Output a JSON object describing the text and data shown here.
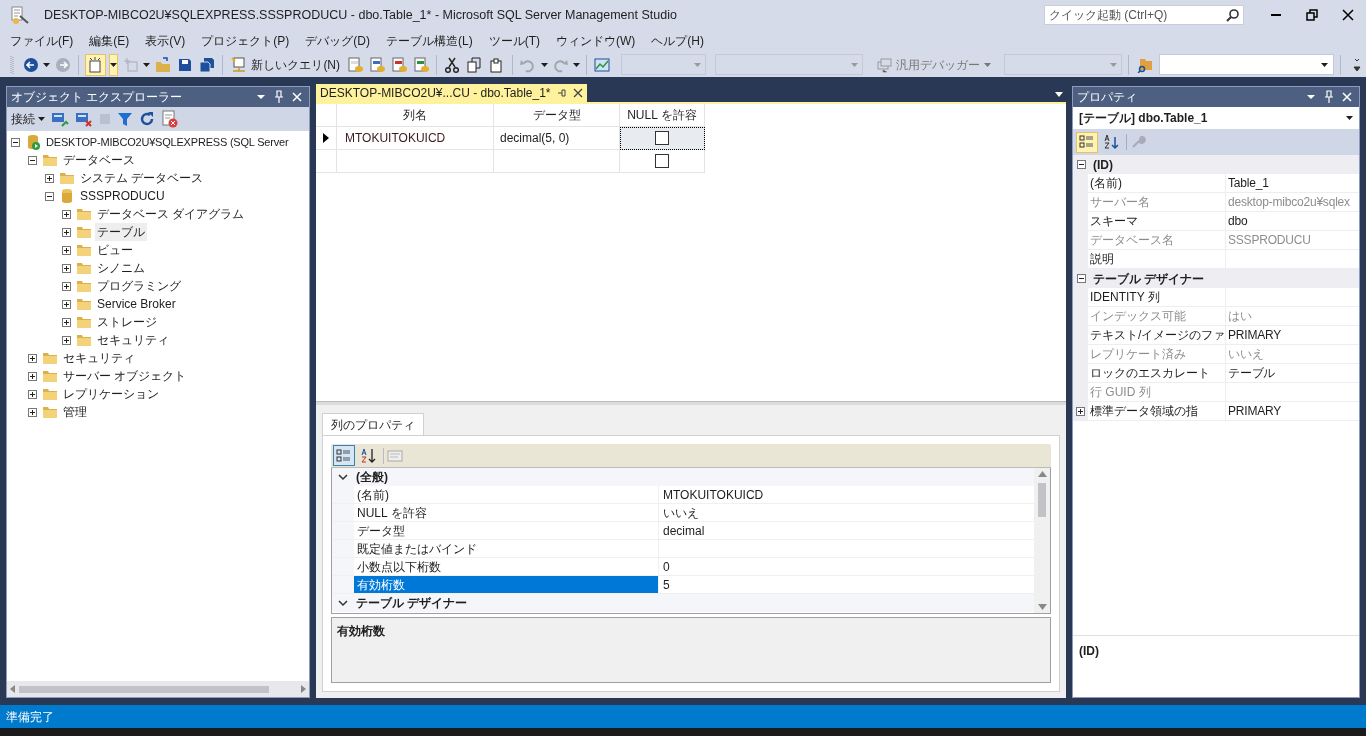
{
  "window": {
    "title": "DESKTOP-MIBCO2U¥SQLEXPRESS.SSSPRODUCU - dbo.Table_1* - Microsoft SQL Server Management Studio"
  },
  "quick_launch": {
    "placeholder": "クイック起動 (Ctrl+Q)"
  },
  "menu": [
    "ファイル(F)",
    "編集(E)",
    "表示(V)",
    "プロジェクト(P)",
    "デバッグ(D)",
    "テーブル構造(L)",
    "ツール(T)",
    "ウィンドウ(W)",
    "ヘルプ(H)"
  ],
  "toolbar": {
    "new_query": "新しいクエリ(N)",
    "debugger": "汎用デバッガー"
  },
  "object_explorer": {
    "title": "オブジェクト エクスプローラー",
    "connect": "接続",
    "tree": [
      {
        "label": "DESKTOP-MIBCO2U¥SQLEXPRESS (SQL Server",
        "kind": "server",
        "expanded": true,
        "selected": false,
        "children": [
          {
            "label": "データベース",
            "kind": "folder",
            "expanded": true,
            "selected": false,
            "children": [
              {
                "label": "システム データベース",
                "kind": "folder",
                "expanded": false,
                "selected": false
              },
              {
                "label": "SSSPRODUCU",
                "kind": "database",
                "expanded": true,
                "selected": false,
                "children": [
                  {
                    "label": "データベース ダイアグラム",
                    "kind": "folder",
                    "expanded": false,
                    "selected": false
                  },
                  {
                    "label": "テーブル",
                    "kind": "folder",
                    "expanded": false,
                    "selected": true
                  },
                  {
                    "label": "ビュー",
                    "kind": "folder",
                    "expanded": false,
                    "selected": false
                  },
                  {
                    "label": "シノニム",
                    "kind": "folder",
                    "expanded": false,
                    "selected": false
                  },
                  {
                    "label": "プログラミング",
                    "kind": "folder",
                    "expanded": false,
                    "selected": false
                  },
                  {
                    "label": "Service Broker",
                    "kind": "folder",
                    "expanded": false,
                    "selected": false
                  },
                  {
                    "label": "ストレージ",
                    "kind": "folder",
                    "expanded": false,
                    "selected": false
                  },
                  {
                    "label": "セキュリティ",
                    "kind": "folder",
                    "expanded": false,
                    "selected": false
                  }
                ]
              }
            ]
          },
          {
            "label": "セキュリティ",
            "kind": "folder",
            "expanded": false,
            "selected": false
          },
          {
            "label": "サーバー オブジェクト",
            "kind": "folder",
            "expanded": false,
            "selected": false
          },
          {
            "label": "レプリケーション",
            "kind": "folder",
            "expanded": false,
            "selected": false
          },
          {
            "label": "管理",
            "kind": "folder",
            "expanded": false,
            "selected": false
          }
        ]
      }
    ]
  },
  "tabs": [
    {
      "label": "DESKTOP-MIBCO2U¥...CU - dbo.Table_1*",
      "selected": true
    }
  ],
  "designer": {
    "columns": [
      "列名",
      "データ型",
      "NULL を許容"
    ],
    "rows": [
      {
        "name": "MTOKUITOKUICD",
        "type": "decimal(5, 0)",
        "allow_null": false,
        "current": true
      },
      {
        "allow_null": false,
        "current": false
      }
    ]
  },
  "column_properties": {
    "tab": "列のプロパティ",
    "description": "有効桁数",
    "grid": [
      {
        "category": "(全般)",
        "expanded": true,
        "rows": [
          {
            "name": "(名前)",
            "value": "MTOKUITOKUICD",
            "selected": false
          },
          {
            "name": "NULL を許容",
            "value": "いいえ",
            "selected": false
          },
          {
            "name": "データ型",
            "value": "decimal",
            "selected": false
          },
          {
            "name": "既定値またはバインド",
            "selected": false
          },
          {
            "name": "小数点以下桁数",
            "value": "0",
            "selected": false
          },
          {
            "name": "有効桁数",
            "value": "5",
            "selected": true
          }
        ]
      },
      {
        "category": "テーブル デザイナー",
        "expanded": true
      }
    ]
  },
  "properties": {
    "title": "プロパティ",
    "object": "[テーブル] dbo.Table_1",
    "description": "(ID)",
    "grid": [
      {
        "category": "(ID)",
        "expanded": true,
        "rows": [
          {
            "name": "(名前)",
            "value": "Table_1",
            "disabled": false
          },
          {
            "name": "サーバー名",
            "value": "desktop-mibco2u¥sqlex",
            "disabled": true
          },
          {
            "name": "スキーマ",
            "value": "dbo",
            "disabled": false
          },
          {
            "name": "データベース名",
            "value": "SSSPRODUCU",
            "disabled": true
          },
          {
            "name": "説明",
            "disabled": false
          }
        ]
      },
      {
        "category": "テーブル デザイナー",
        "expanded": true,
        "rows": [
          {
            "name": "IDENTITY 列",
            "disabled": false
          },
          {
            "name": "インデックス可能",
            "value": "はい",
            "disabled": true
          },
          {
            "name": "テキスト/イメージのファ",
            "value": "PRIMARY",
            "disabled": false
          },
          {
            "name": "レプリケート済み",
            "value": "いいえ",
            "disabled": true
          },
          {
            "name": "ロックのエスカレート",
            "value": "テーブル",
            "disabled": false
          },
          {
            "name": "行 GUID 列",
            "disabled": true
          },
          {
            "name": "標準データ領域の指",
            "value": "PRIMARY",
            "disabled": false,
            "expanded": false
          }
        ]
      }
    ]
  },
  "status_bar": {
    "text": "準備完了"
  }
}
